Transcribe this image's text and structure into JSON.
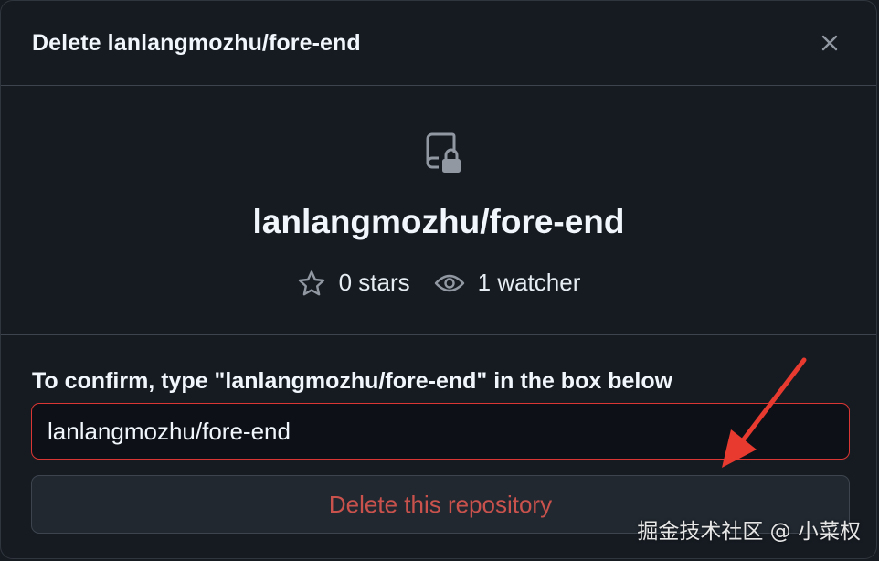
{
  "dialog": {
    "title": "Delete lanlangmozhu/fore-end",
    "close_icon": "x-icon"
  },
  "repo": {
    "icon": "repo-locked-icon",
    "name": "lanlangmozhu/fore-end",
    "stars": "0 stars",
    "watchers": "1 watcher"
  },
  "confirm": {
    "label": "To confirm, type \"lanlangmozhu/fore-end\" in the box below",
    "input_value": "lanlangmozhu/fore-end",
    "button_label": "Delete this repository"
  },
  "annotation": {
    "arrow_color": "#e83a2f"
  },
  "watermark": "掘金技术社区 @ 小菜权",
  "colors": {
    "background": "#161b22",
    "danger": "#da3633",
    "danger_text": "#c9524d"
  }
}
